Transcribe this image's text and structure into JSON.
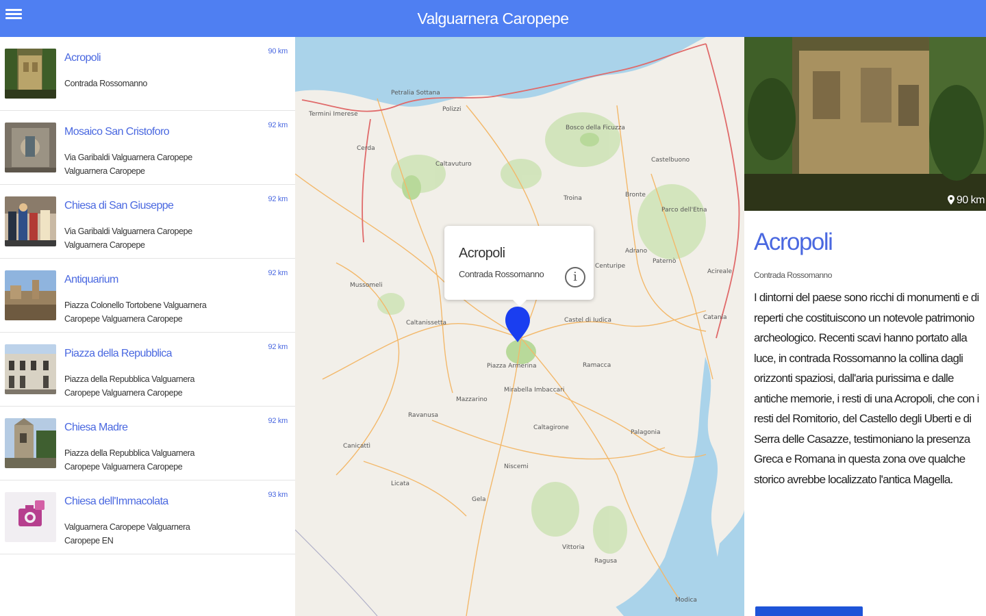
{
  "app": {
    "title": "Valguarnera Caropepe",
    "accent_color": "#4f7ff2"
  },
  "list": {
    "items": [
      {
        "title": "Acropoli",
        "address": "Contrada Rossomanno",
        "distance": "90 km",
        "thumb": "ruins-photo"
      },
      {
        "title": "Mosaico San Cristoforo",
        "address": "Via Garibaldi Valguarnera Caropepe Valguarnera Caropepe",
        "distance": "92 km",
        "thumb": "mosaic-photo"
      },
      {
        "title": "Chiesa di San Giuseppe",
        "address": "Via Garibaldi Valguarnera Caropepe Valguarnera Caropepe",
        "distance": "92 km",
        "thumb": "procession-photo"
      },
      {
        "title": "Antiquarium",
        "address": "Piazza Colonello Tortobene Valguarnera Caropepe Valguarnera Caropepe",
        "distance": "92 km",
        "thumb": "town-photo"
      },
      {
        "title": "Piazza della Repubblica",
        "address": "Piazza della Repubblica Valguarnera Caropepe Valguarnera Caropepe",
        "distance": "92 km",
        "thumb": "building-photo"
      },
      {
        "title": "Chiesa Madre",
        "address": "Piazza della Repubblica Valguarnera Caropepe Valguarnera Caropepe",
        "distance": "92 km",
        "thumb": "church-photo"
      },
      {
        "title": "Chiesa dell'Immacolata",
        "address": "Valguarnera Caropepe Valguarnera Caropepe EN",
        "distance": "93 km",
        "thumb": "camera-placeholder-icon"
      }
    ]
  },
  "map": {
    "popup": {
      "title": "Acropoli",
      "subtitle": "Contrada Rossomanno",
      "info_icon": "info-icon"
    },
    "pin_color": "#1a3ef0",
    "labels": [
      "Termini Imerese",
      "Polizzi",
      "Cerda",
      "Caltavuturo",
      "Petralia Sottana",
      "Bosco della Ficuzza",
      "Castelbuono",
      "Troina",
      "Bronte",
      "Parco dell'Etna",
      "Adrano",
      "Paternò",
      "Centuripe",
      "Mussomeli",
      "Caltanissetta",
      "Castel di Iudica",
      "Piazza Armerina",
      "Mazzarino",
      "Ramacca",
      "Caltagirone",
      "Gela",
      "Niscemi",
      "Vittoria",
      "Ragusa",
      "Catania",
      "Acireale",
      "Licata",
      "Canicattì",
      "Ravanusa",
      "Palagonia",
      "Mirabella Imbaccari",
      "Modica"
    ]
  },
  "detail": {
    "distance": "90 km",
    "title": "Acropoli",
    "address": "Contrada Rossomanno",
    "description": "I dintorni del paese sono ricchi di monumenti e di reperti che costituiscono un notevole patrimonio archeologico. Recenti scavi hanno portato alla luce, in contrada Rossomanno la collina dagli orizzonti spaziosi, dall'aria purissima e dalle antiche memorie, i resti di una Acropoli, che con i resti del Romitorio, del Castello degli Uberti e di Serra delle Casazze, testimoniano la presenza Greca e Romana in questa zona ove qualche storico avrebbe localizzato l'antica Magella."
  }
}
